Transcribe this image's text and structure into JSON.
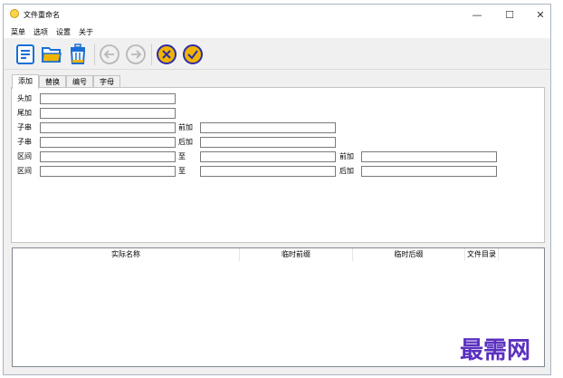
{
  "window": {
    "title": "文件重命名"
  },
  "controls": {
    "minimize": "—",
    "maximize": "☐",
    "close": "✕"
  },
  "menu": [
    "菜单",
    "选项",
    "设置",
    "关于"
  ],
  "toolbar": [
    {
      "icon": "list-document-icon",
      "color": "#1a6fd6"
    },
    {
      "icon": "open-folder-icon",
      "color": "#f0b400"
    },
    {
      "icon": "trash-icon",
      "color": "#1a6fd6"
    },
    {
      "icon": "back-arrow-icon",
      "color": "#b8b8b8"
    },
    {
      "icon": "forward-arrow-icon",
      "color": "#b8b8b8"
    },
    {
      "icon": "cancel-icon",
      "color": "#2c2ca8"
    },
    {
      "icon": "confirm-icon",
      "color": "#2c2ca8"
    }
  ],
  "tabs": [
    "添加",
    "替换",
    "编号",
    "字母"
  ],
  "form": {
    "head": "头加",
    "tail": "尾加",
    "substr1": "子串",
    "prefix1": "前加",
    "substr2": "子串",
    "suffix2": "后加",
    "range1": "区间",
    "to1": "至",
    "prefix3": "前加",
    "range2": "区间",
    "to2": "至",
    "suffix4": "后加"
  },
  "list": {
    "columns": [
      "实际名称",
      "临时前缀",
      "临时后缀",
      "文件目录"
    ]
  },
  "watermark": "最需网"
}
